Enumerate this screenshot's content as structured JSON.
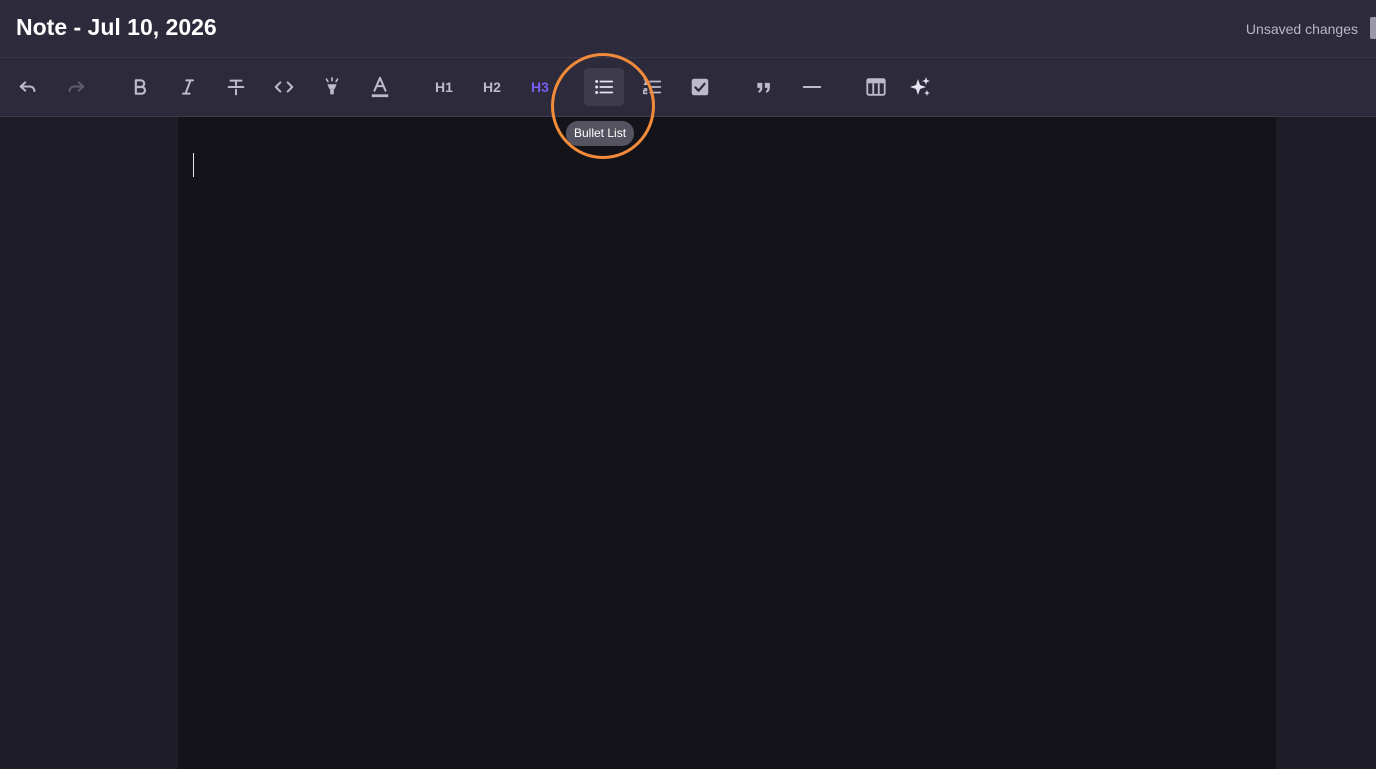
{
  "header": {
    "title": "Note - Jul 10, 2026",
    "status": "Unsaved changes"
  },
  "toolbar": {
    "h1_label": "H1",
    "h2_label": "H2",
    "h3_label": "H3",
    "buttons": [
      {
        "name": "undo",
        "icon": "undo-icon"
      },
      {
        "name": "redo",
        "icon": "redo-icon",
        "disabled": true
      },
      {
        "name": "bold",
        "icon": "bold-icon"
      },
      {
        "name": "italic",
        "icon": "italic-icon"
      },
      {
        "name": "strikethrough",
        "icon": "strikethrough-icon"
      },
      {
        "name": "code",
        "icon": "code-icon"
      },
      {
        "name": "highlight",
        "icon": "highlighter-icon"
      },
      {
        "name": "text-color",
        "icon": "text-color-icon"
      },
      {
        "name": "heading-1",
        "label": "H1"
      },
      {
        "name": "heading-2",
        "label": "H2"
      },
      {
        "name": "heading-3",
        "label": "H3",
        "active": true
      },
      {
        "name": "bullet-list",
        "icon": "bullet-list-icon",
        "hovered": true
      },
      {
        "name": "ordered-list",
        "icon": "ordered-list-icon"
      },
      {
        "name": "task-list",
        "icon": "checkbox-icon"
      },
      {
        "name": "blockquote",
        "icon": "quote-icon"
      },
      {
        "name": "horizontal-rule",
        "icon": "horizontal-rule-icon"
      },
      {
        "name": "table",
        "icon": "table-icon"
      },
      {
        "name": "ai-assist",
        "icon": "sparkles-icon"
      }
    ]
  },
  "tooltip": {
    "text": "Bullet List"
  },
  "colors": {
    "titlebar_bg": "#2c2a3b",
    "page_bg": "#1e1c27",
    "editor_bg": "#141319",
    "accent_purple": "#7c5cf0",
    "highlight_orange": "#f28b3a",
    "icon_gray": "#bdbbc9"
  }
}
